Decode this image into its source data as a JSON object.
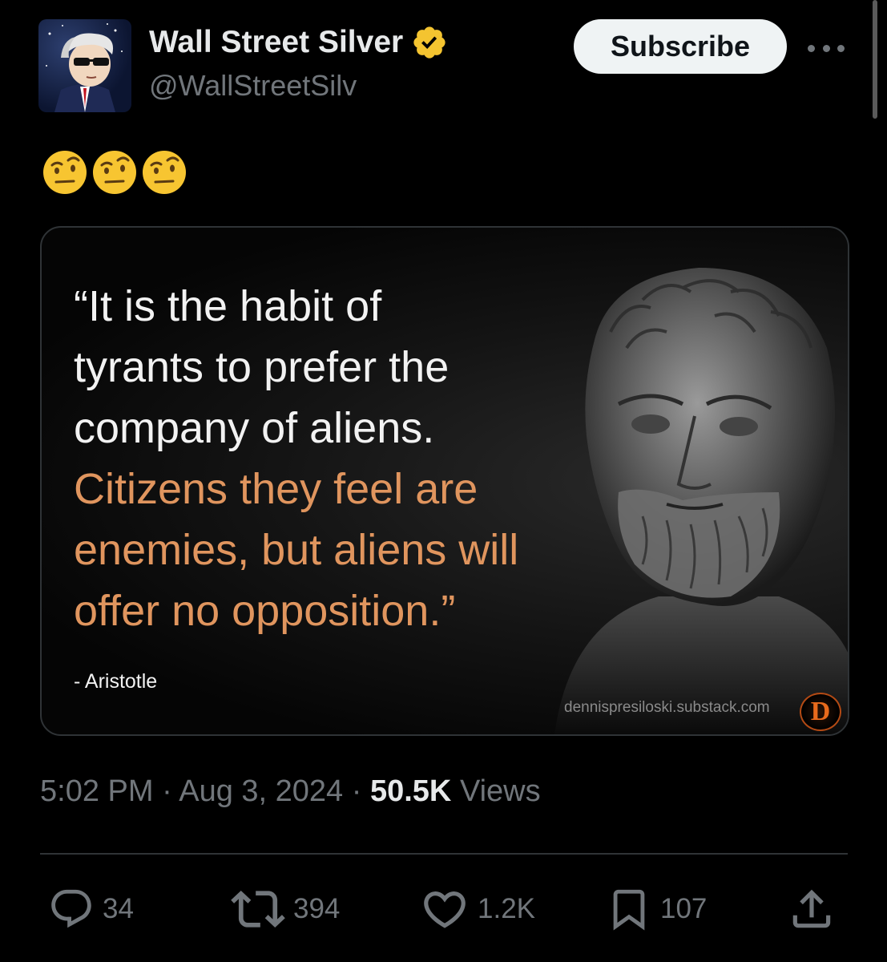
{
  "author": {
    "display_name": "Wall Street Silver",
    "handle": "@WallStreetSilv",
    "verified_color": "#f4c430"
  },
  "header": {
    "subscribe_label": "Subscribe"
  },
  "post": {
    "text": "🤨🤨🤨",
    "image": {
      "quote_white": [
        "“It is the habit of",
        "tyrants to prefer the",
        "company of aliens."
      ],
      "quote_orange": [
        "Citizens they feel are",
        "enemies, but aliens will",
        "offer no opposition.”"
      ],
      "attribution": "- Aristotle",
      "watermark": "dennispresiloski.substack.com",
      "logo_letter": "D"
    },
    "time": "5:02 PM",
    "date": "Aug 3, 2024",
    "views_count": "50.5K",
    "views_label": "Views"
  },
  "actions": {
    "replies": "34",
    "reposts": "394",
    "likes": "1.2K",
    "bookmarks": "107"
  },
  "colors": {
    "background": "#000000",
    "secondary_text": "#71767b",
    "quote_orange": "#e0955e"
  }
}
